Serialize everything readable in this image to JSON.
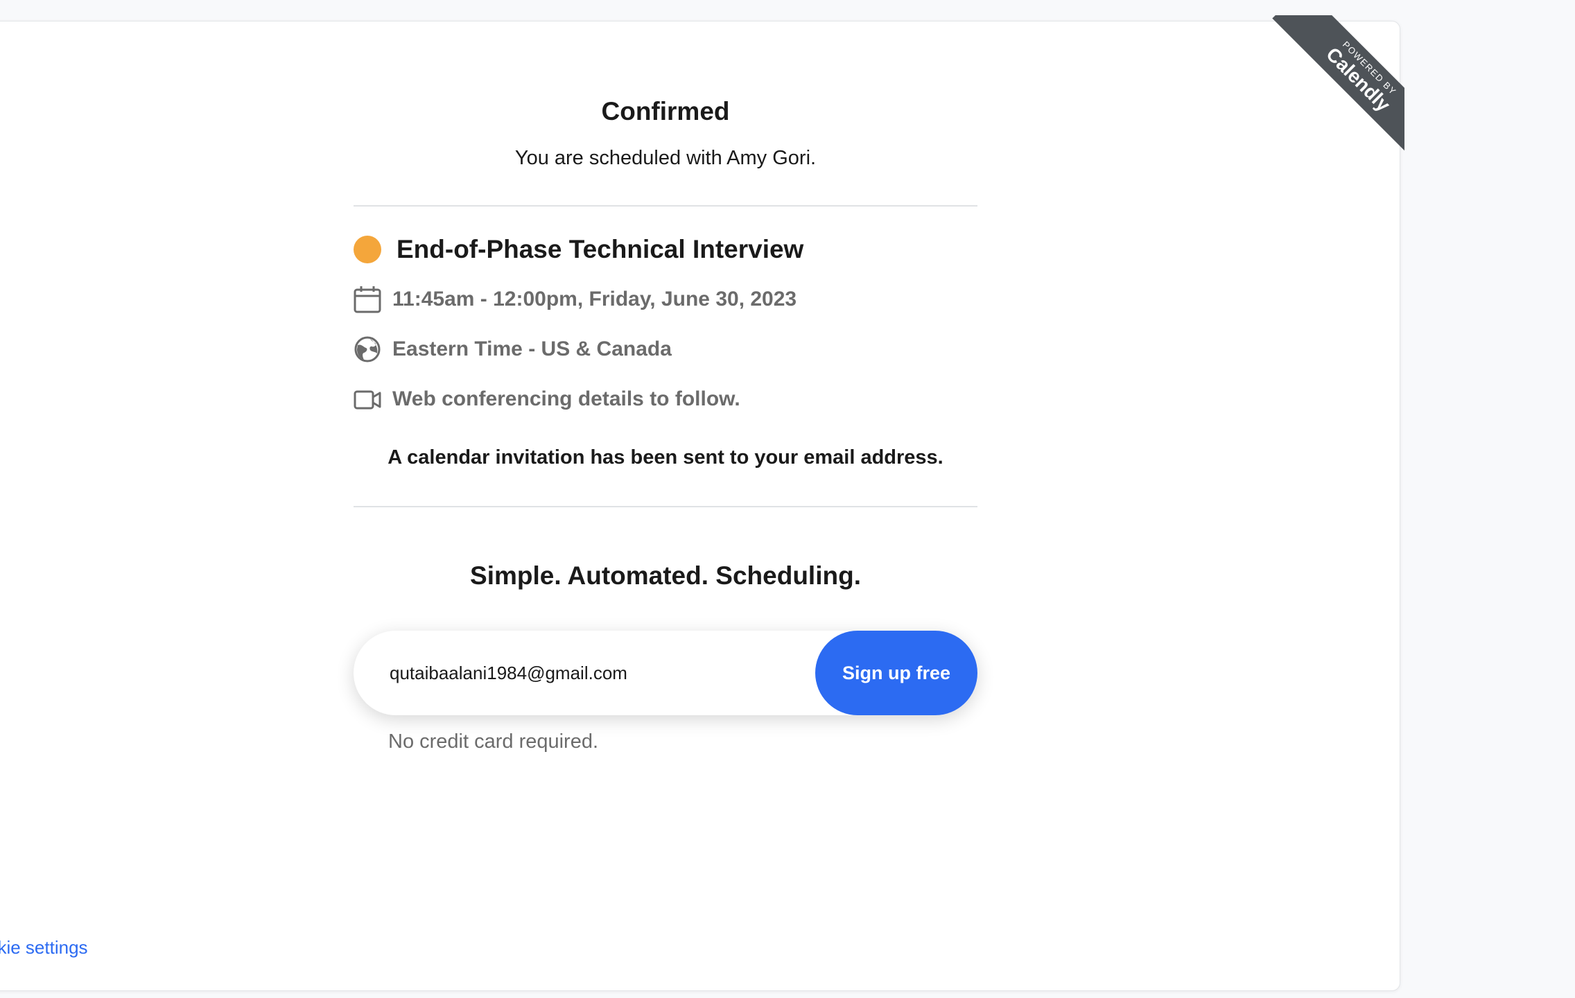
{
  "header": {
    "title": "Confirmed",
    "subtitle": "You are scheduled with Amy Gori."
  },
  "ribbon": {
    "small_text": "POWERED BY",
    "brand_text": "Calendly"
  },
  "event": {
    "name": "End-of-Phase Technical Interview",
    "color": "#f4a63b",
    "details": [
      {
        "icon": "calendar-icon",
        "text": "11:45am - 12:00pm, Friday, June 30, 2023"
      },
      {
        "icon": "globe-icon",
        "text": "Eastern Time - US & Canada"
      },
      {
        "icon": "video-icon",
        "text": "Web conferencing details to follow."
      }
    ],
    "invite_note": "A calendar invitation has been sent to your email address."
  },
  "promo": {
    "title": "Simple. Automated. Scheduling.",
    "email_value": "qutaibaalani1984@gmail.com",
    "button_label": "Sign up free",
    "note": "No credit card required."
  },
  "footer": {
    "cookie_link": "okie settings"
  },
  "colors": {
    "accent": "#2c6bf2",
    "ribbon": "#4e5358",
    "event_dot": "#f4a63b"
  }
}
